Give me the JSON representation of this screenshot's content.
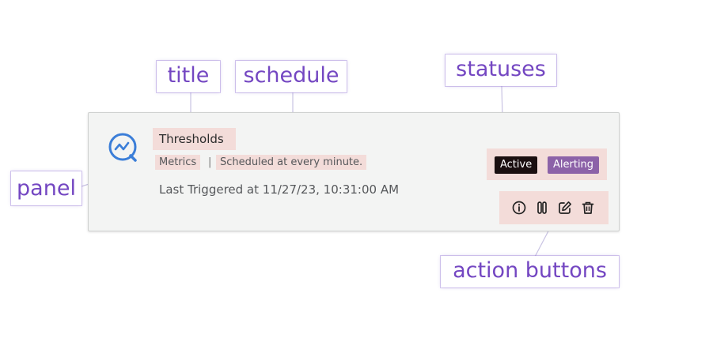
{
  "alert": {
    "title": "Thresholds",
    "panel": "Metrics",
    "separator": "|",
    "schedule": "Scheduled at every minute.",
    "last_triggered": "Last Triggered at 11/27/23, 10:31:00 AM",
    "statuses": [
      {
        "label": "Active",
        "color": "#1a0f10"
      },
      {
        "label": "Alerting",
        "color": "#8c62a8"
      }
    ],
    "actions": [
      {
        "icon": "info-icon"
      },
      {
        "icon": "pause-icon"
      },
      {
        "icon": "edit-icon"
      },
      {
        "icon": "trash-icon"
      }
    ],
    "alert_icon": "alert-chart-icon"
  },
  "callouts": {
    "title": "title",
    "schedule": "schedule",
    "statuses": "statuses",
    "panel": "panel",
    "action_buttons": "action buttons"
  },
  "colors": {
    "highlight": "#f3dcd9",
    "callout_text": "#7447c2",
    "icon_blue": "#3b7ed8"
  }
}
